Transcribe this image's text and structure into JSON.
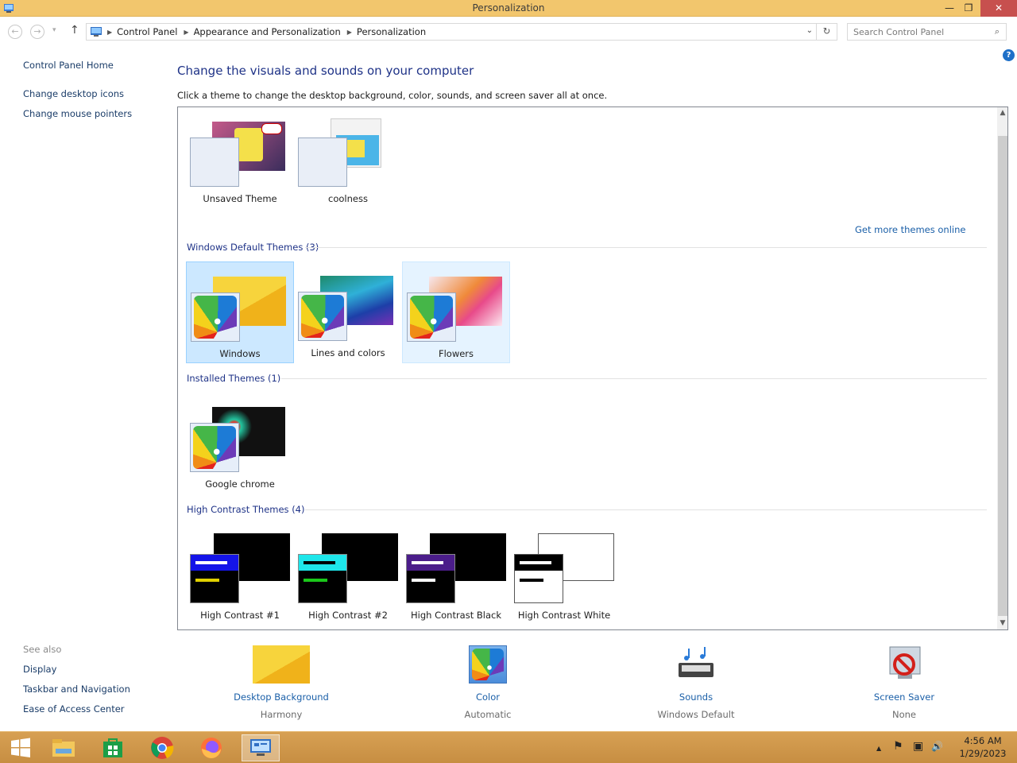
{
  "window": {
    "title": "Personalization",
    "minimize": "—",
    "restore": "❐",
    "close": "✕"
  },
  "address": {
    "crumbs": [
      "Control Panel",
      "Appearance and Personalization",
      "Personalization"
    ],
    "dropdown": "⌄",
    "refresh": "↻"
  },
  "search": {
    "placeholder": "Search Control Panel"
  },
  "nav": {
    "back": "←",
    "forward": "→",
    "up": "↑"
  },
  "help": "?",
  "sidebar": {
    "links": [
      "Control Panel Home",
      "Change desktop icons",
      "Change mouse pointers"
    ],
    "see_also": "See also",
    "see_also_links": [
      "Display",
      "Taskbar and Navigation",
      "Ease of Access Center"
    ]
  },
  "main": {
    "heading": "Change the visuals and sounds on your computer",
    "subtext": "Click a theme to change the desktop background, color, sounds, and screen saver all at once.",
    "get_more": "Get more themes online",
    "my_themes": [
      "Unsaved Theme",
      "coolness"
    ],
    "groups": {
      "default": {
        "label": "Windows Default Themes (3)",
        "themes": [
          "Windows",
          "Lines and colors",
          "Flowers"
        ]
      },
      "installed": {
        "label": "Installed Themes (1)",
        "themes": [
          "Google chrome"
        ]
      },
      "high_contrast": {
        "label": "High Contrast Themes (4)",
        "themes": [
          "High Contrast #1",
          "High Contrast #2",
          "High Contrast Black",
          "High Contrast White"
        ]
      }
    }
  },
  "bottom": {
    "desktop_background": {
      "name": "Desktop Background",
      "value": "Harmony"
    },
    "color": {
      "name": "Color",
      "value": "Automatic"
    },
    "sounds": {
      "name": "Sounds",
      "value": "Windows Default"
    },
    "screen_saver": {
      "name": "Screen Saver",
      "value": "None"
    }
  },
  "taskbar": {
    "apps": [
      "start-icon",
      "file-explorer-icon",
      "store-icon",
      "chrome-icon",
      "firefox-icon",
      "control-panel-icon"
    ],
    "tray": {
      "up": "▲",
      "flag": "⚑",
      "network": "▣",
      "volume": "🔊"
    },
    "time": "4:56 AM",
    "date": "1/29/2023"
  }
}
